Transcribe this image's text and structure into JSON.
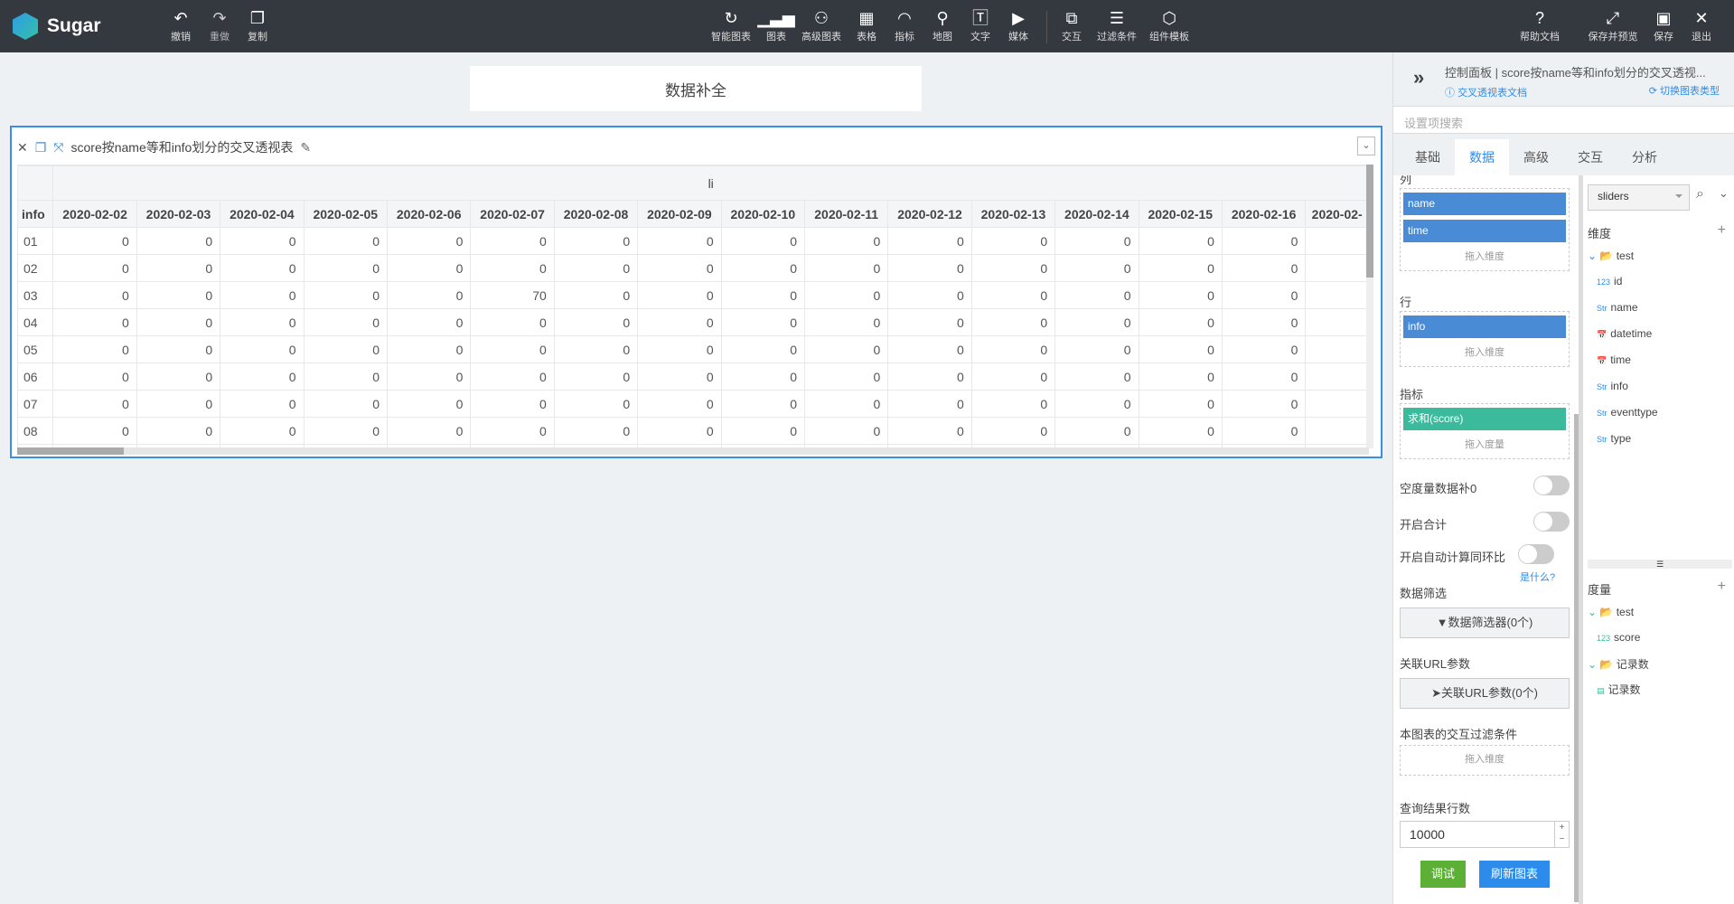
{
  "app": {
    "name": "Sugar"
  },
  "toolbar": {
    "left": [
      {
        "icon": "undo-icon",
        "label": "撤销"
      },
      {
        "icon": "redo-icon",
        "label": "重做"
      },
      {
        "icon": "copy-icon",
        "label": "复制"
      }
    ],
    "center": [
      {
        "icon": "smart-chart-icon",
        "label": "智能图表"
      },
      {
        "icon": "bar-chart-icon",
        "label": "图表"
      },
      {
        "icon": "advanced-chart-icon",
        "label": "高级图表"
      },
      {
        "icon": "table-icon",
        "label": "表格"
      },
      {
        "icon": "gauge-icon",
        "label": "指标"
      },
      {
        "icon": "map-icon",
        "label": "地图"
      },
      {
        "icon": "text-icon",
        "label": "文字"
      },
      {
        "icon": "media-icon",
        "label": "媒体"
      },
      {
        "icon": "interaction-icon",
        "label": "交互"
      },
      {
        "icon": "filter-icon",
        "label": "过滤条件"
      },
      {
        "icon": "template-icon",
        "label": "组件模板"
      }
    ],
    "right": [
      {
        "icon": "help-icon",
        "label": "帮助文档"
      },
      {
        "icon": "expand-icon",
        "label": "保存并预览"
      },
      {
        "icon": "save-icon",
        "label": "保存"
      },
      {
        "icon": "close-icon",
        "label": "退出"
      }
    ]
  },
  "canvas": {
    "title": "数据补全"
  },
  "widget": {
    "title": "score按name等和info划分的交叉透视表",
    "group_header": "li",
    "row_header": "info",
    "columns": [
      "2020-02-02",
      "2020-02-03",
      "2020-02-04",
      "2020-02-05",
      "2020-02-06",
      "2020-02-07",
      "2020-02-08",
      "2020-02-09",
      "2020-02-10",
      "2020-02-11",
      "2020-02-12",
      "2020-02-13",
      "2020-02-14",
      "2020-02-15",
      "2020-02-16",
      "2020-02-"
    ],
    "rows": [
      {
        "key": "01",
        "values": [
          "0",
          "0",
          "0",
          "0",
          "0",
          "0",
          "0",
          "0",
          "0",
          "0",
          "0",
          "0",
          "0",
          "0",
          "0",
          ""
        ]
      },
      {
        "key": "02",
        "values": [
          "0",
          "0",
          "0",
          "0",
          "0",
          "0",
          "0",
          "0",
          "0",
          "0",
          "0",
          "0",
          "0",
          "0",
          "0",
          ""
        ]
      },
      {
        "key": "03",
        "values": [
          "0",
          "0",
          "0",
          "0",
          "0",
          "70",
          "0",
          "0",
          "0",
          "0",
          "0",
          "0",
          "0",
          "0",
          "0",
          ""
        ]
      },
      {
        "key": "04",
        "values": [
          "0",
          "0",
          "0",
          "0",
          "0",
          "0",
          "0",
          "0",
          "0",
          "0",
          "0",
          "0",
          "0",
          "0",
          "0",
          ""
        ]
      },
      {
        "key": "05",
        "values": [
          "0",
          "0",
          "0",
          "0",
          "0",
          "0",
          "0",
          "0",
          "0",
          "0",
          "0",
          "0",
          "0",
          "0",
          "0",
          ""
        ]
      },
      {
        "key": "06",
        "values": [
          "0",
          "0",
          "0",
          "0",
          "0",
          "0",
          "0",
          "0",
          "0",
          "0",
          "0",
          "0",
          "0",
          "0",
          "0",
          ""
        ]
      },
      {
        "key": "07",
        "values": [
          "0",
          "0",
          "0",
          "0",
          "0",
          "0",
          "0",
          "0",
          "0",
          "0",
          "0",
          "0",
          "0",
          "0",
          "0",
          ""
        ]
      },
      {
        "key": "08",
        "values": [
          "0",
          "0",
          "0",
          "0",
          "0",
          "0",
          "0",
          "0",
          "0",
          "0",
          "0",
          "0",
          "0",
          "0",
          "0",
          ""
        ]
      },
      {
        "key": "",
        "values": [
          "0",
          "0",
          "0",
          "0",
          "0",
          "0",
          "0",
          "0",
          "0",
          "0",
          "0",
          "0",
          "0",
          "0",
          "0",
          ""
        ]
      }
    ]
  },
  "panel": {
    "title": "控制面板 | score按name等和info划分的交叉透视...",
    "doc_link": "交叉透视表文档",
    "switch_type": "切换图表类型",
    "search_placeholder": "设置项搜索",
    "tabs": [
      "基础",
      "数据",
      "高级",
      "交互",
      "分析"
    ],
    "active_tab": "数据",
    "columns_label": "列",
    "columns": [
      "name",
      "time"
    ],
    "drop_dimension": "拖入维度",
    "rows_label": "行",
    "rows": [
      "info"
    ],
    "metrics_label": "指标",
    "metrics": [
      "求和(score)"
    ],
    "drop_measure": "拖入度量",
    "fill_zero": {
      "label": "空度量数据补0",
      "on": false
    },
    "total": {
      "label": "开启合计",
      "on": false
    },
    "yoy": {
      "label": "开启自动计算同环比",
      "on": false
    },
    "what": "是什么?",
    "filter_label": "数据筛选",
    "filter_button": "数据筛选器(0个)",
    "url_label": "关联URL参数",
    "url_button": "关联URL参数(0个)",
    "interaction_label": "本图表的交互过滤条件",
    "rows_limit_label": "查询结果行数",
    "rows_limit": "10000",
    "debug": "调试",
    "refresh": "刷新图表",
    "datasource": "sliders",
    "dimension_label": "维度",
    "dimension_folder": "test",
    "dimension_fields": [
      {
        "type": "123",
        "name": "id"
      },
      {
        "type": "Str",
        "name": "name"
      },
      {
        "type": "date",
        "name": "datetime"
      },
      {
        "type": "date",
        "name": "time"
      },
      {
        "type": "Str",
        "name": "info"
      },
      {
        "type": "Str",
        "name": "eventtype"
      },
      {
        "type": "Str",
        "name": "type"
      }
    ],
    "measure_label": "度量",
    "measure_folders": [
      {
        "name": "test",
        "fields": [
          {
            "type": "123",
            "name": "score"
          }
        ]
      },
      {
        "name": "记录数",
        "fields": [
          {
            "type": "count",
            "name": "记录数"
          }
        ]
      }
    ]
  },
  "colors": {
    "topbar": "#343940",
    "accent": "#3a8ee6",
    "pill_blue": "#4a8bd6",
    "pill_green": "#3bba9c",
    "debug": "#5bb035",
    "refresh": "#2d8ceb"
  }
}
